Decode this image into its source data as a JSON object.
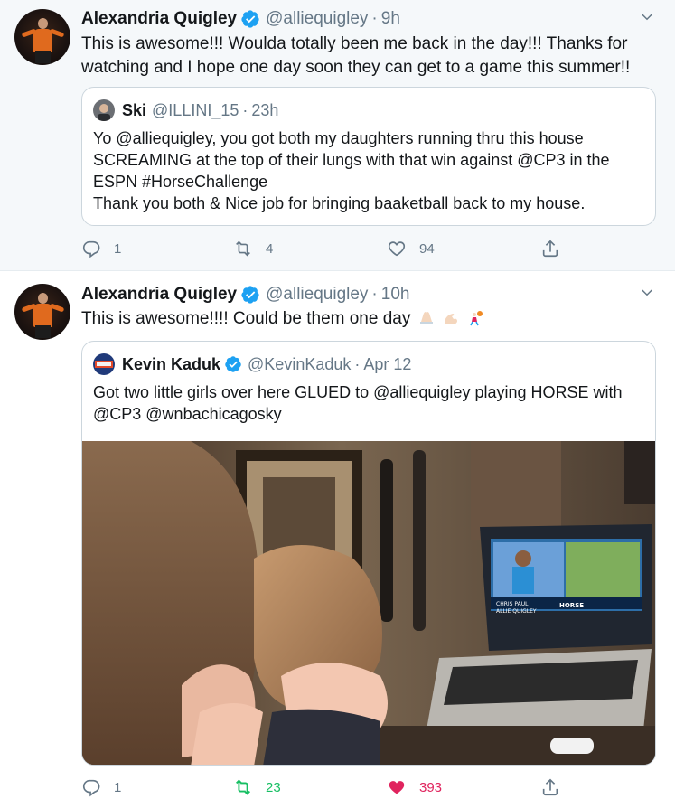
{
  "tweets": [
    {
      "author_name": "Alexandria Quigley",
      "handle": "@alliequigley",
      "separator": "·",
      "time": "9h",
      "text_line1": "This is awesome!!! Woulda totally been me back in the day!!! Thanks for",
      "text_line2": "watching and I hope one day soon they can get to a game this summer!!",
      "quote": {
        "author_name": "Ski",
        "handle": "@ILLINI_15",
        "separator": "·",
        "time": "23h",
        "text_lines": [
          "Yo @alliequigley, you got both my daughters running thru this house",
          "SCREAMING at the top of their lungs with that win against @CP3 in the",
          "ESPN #HorseChallenge",
          "Thank you both & Nice job for bringing baaketball back to my house."
        ]
      },
      "actions": {
        "replies": "1",
        "retweets": "4",
        "likes": "94"
      }
    },
    {
      "author_name": "Alexandria Quigley",
      "handle": "@alliequigley",
      "separator": "·",
      "time": "10h",
      "text": "This is awesome!!!! Could be them one day",
      "quote": {
        "author_name": "Kevin Kaduk",
        "handle": "@KevinKaduk",
        "separator": "·",
        "time": "Apr 12",
        "text_lines": [
          "Got two little girls over here GLUED to @alliequigley playing HORSE with",
          "@CP3  @wnbachicagosky"
        ],
        "screen_text_name": "CHRIS PAUL",
        "screen_text_name2": "ALLIE QUIGLEY",
        "screen_text_game": "HORSE"
      },
      "actions": {
        "replies": "1",
        "retweets": "23",
        "likes": "393"
      }
    }
  ],
  "colors": {
    "verified_blue": "#1da1f2",
    "muted_gray": "#657786",
    "retweet_green": "#17bf63",
    "like_red": "#e0245e",
    "highlight_bg": "#f5f8fa"
  },
  "icons": [
    "verified-badge-icon",
    "caret-down-icon",
    "reply-icon",
    "retweet-icon",
    "like-icon",
    "share-icon"
  ]
}
